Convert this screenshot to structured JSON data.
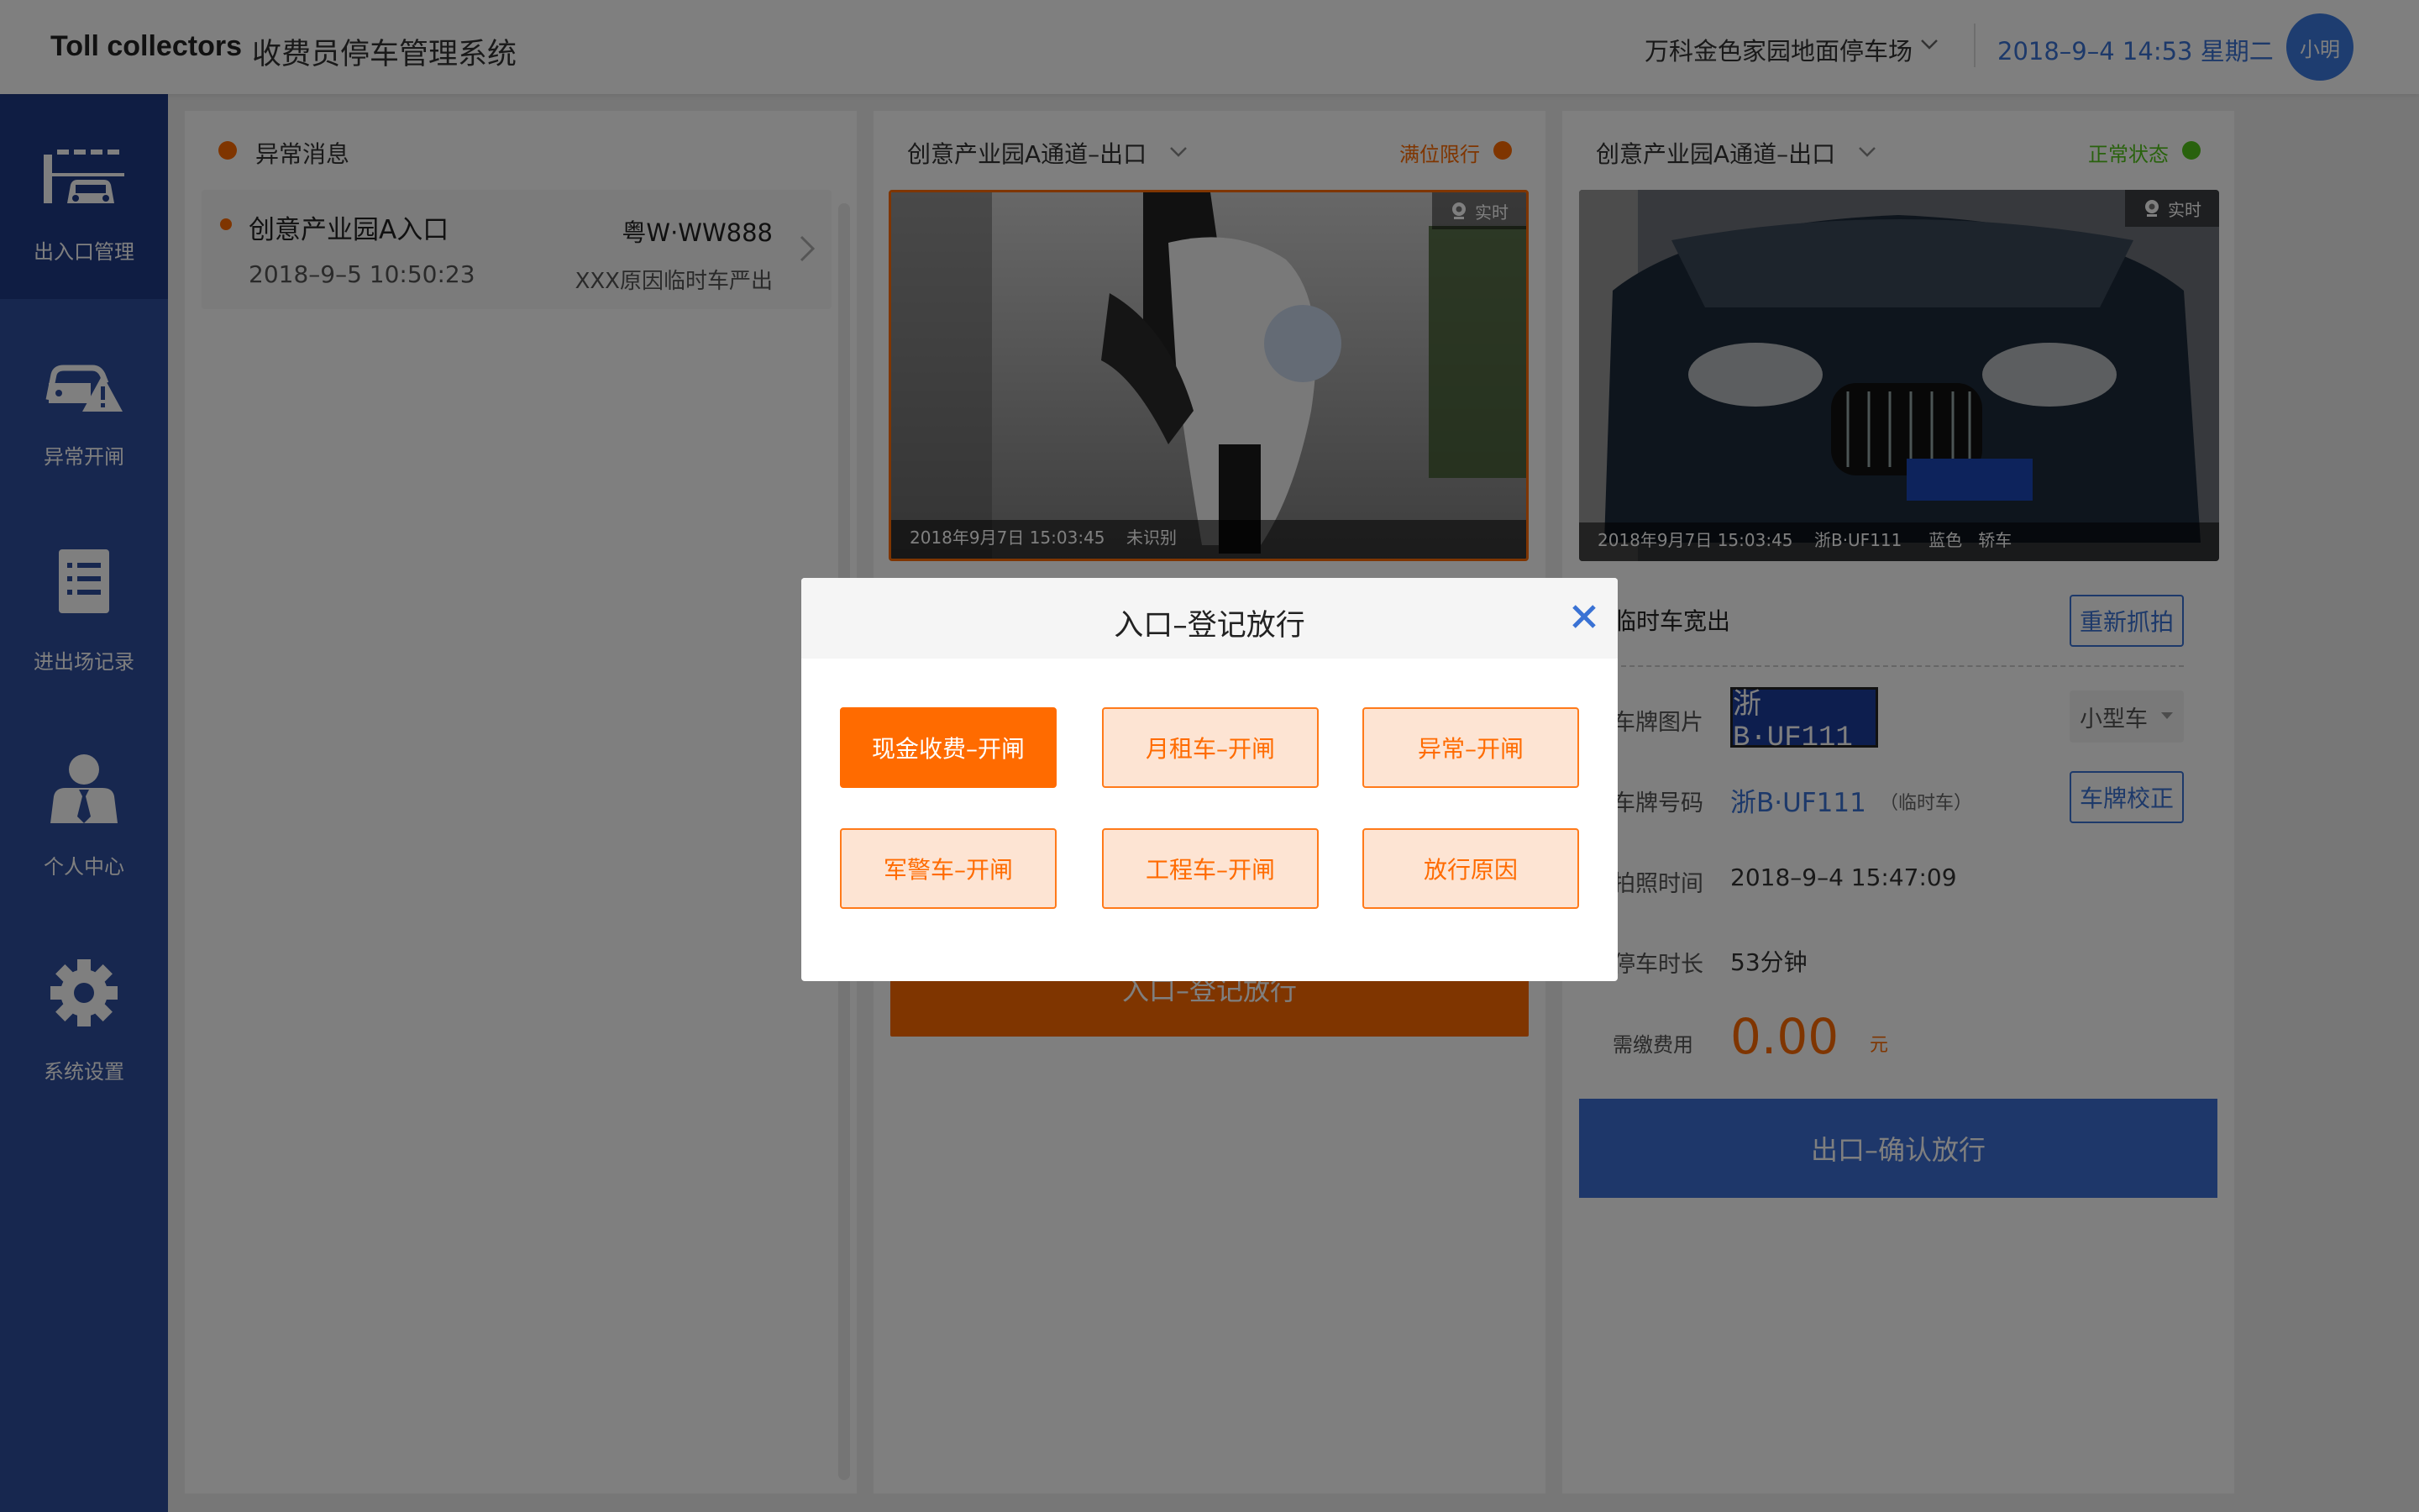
{
  "header": {
    "brand_en": "Toll collectors",
    "brand_cn": "收费员停车管理系统",
    "parking_lot": "万科金色家园地面停车场",
    "datetime": "2018–9–4 14:53 星期二",
    "user_name": "小明"
  },
  "sidebar": {
    "items": [
      {
        "label": "出入口管理",
        "icon": "gate-icon",
        "active": true
      },
      {
        "label": "异常开闸",
        "icon": "car-warning-icon",
        "active": false
      },
      {
        "label": "进出场记录",
        "icon": "list-icon",
        "active": false
      },
      {
        "label": "个人中心",
        "icon": "person-icon",
        "active": false
      },
      {
        "label": "系统设置",
        "icon": "gear-icon",
        "active": false
      }
    ]
  },
  "messages_panel": {
    "title": "异常消息",
    "items": [
      {
        "title": "创意产业园A入口",
        "time": "2018–9–5 10:50:23",
        "plate": "粤W·WW888",
        "reason": "XXX原因临时车严出"
      }
    ]
  },
  "channel_a": {
    "name": "创意产业园A通道–出口",
    "status": "满位限行",
    "camera_live": "实时",
    "camera_time": "2018年9月7日 15:03:45",
    "camera_result": "未识别",
    "action_button": "入口–登记放行"
  },
  "channel_b": {
    "name": "创意产业园A通道–出口",
    "status": "正常状态",
    "camera_live": "实时",
    "camera_time": "2018年9月7日 15:03:45",
    "camera_plate": "浙B·UF111",
    "camera_color": "蓝色",
    "camera_type": "轿车",
    "section_title": "临时车宽出",
    "recapture_button": "重新抓拍",
    "plate_image_label": "车牌图片",
    "plate_image_text": "浙B·UF111",
    "vehicle_size": "小型车",
    "plate_number_label": "车牌号码",
    "plate_number": "浙B·UF111",
    "plate_kind": "（临时车）",
    "correct_button": "车牌校正",
    "capture_time_label": "拍照时间",
    "capture_time": "2018–9–4 15:47:09",
    "duration_label": "停车时长",
    "duration": "53分钟",
    "fee_label": "需缴费用",
    "fee": "0.00",
    "fee_unit": "元",
    "confirm_button": "出口–确认放行"
  },
  "modal": {
    "title": "入口–登记放行",
    "options": [
      "现金收费–开闸",
      "月租车–开闸",
      "异常–开闸",
      "军警车–开闸",
      "工程车–开闸",
      "放行原因"
    ]
  },
  "colors": {
    "brand_blue": "#2f4e9e",
    "accent_orange": "#ff6b00",
    "link_blue": "#3a72d4",
    "status_green": "#52c41a"
  }
}
